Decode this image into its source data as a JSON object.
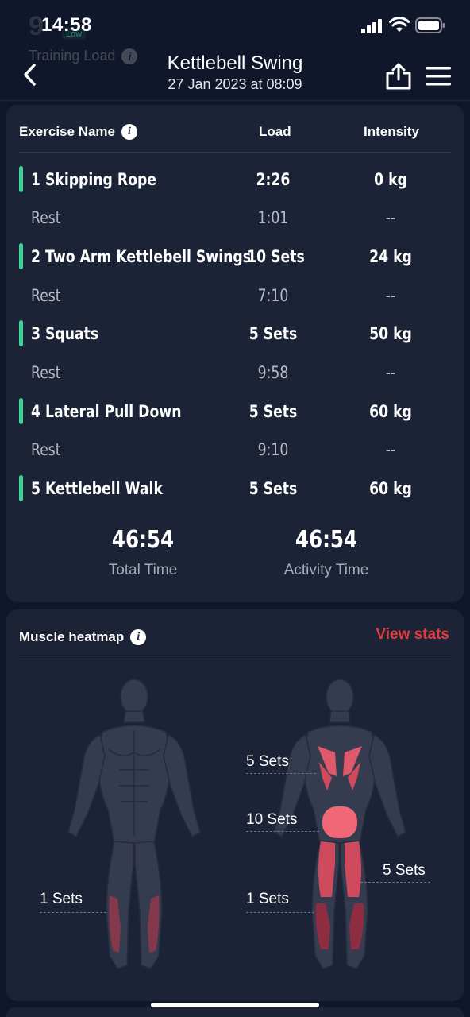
{
  "status_bar": {
    "time": "14:58",
    "ghost_number": "9",
    "ghost_badge": "Low"
  },
  "header": {
    "ghost_label": "Training Load",
    "title": "Kettlebell Swing",
    "subtitle": "27 Jan 2023 at 08:09",
    "icons": [
      "back-icon",
      "share-icon",
      "menu-icon"
    ]
  },
  "exercises": {
    "col_name": "Exercise Name",
    "col_load": "Load",
    "col_intensity": "Intensity",
    "accent_color": "#3fd49a",
    "rows": [
      {
        "name": "1 Skipping Rope",
        "load": "2:26",
        "intensity": "0 kg",
        "rest": false
      },
      {
        "name": "Rest",
        "load": "1:01",
        "intensity": "--",
        "rest": true
      },
      {
        "name": "2 Two Arm Kettlebell Swings",
        "load": "10 Sets",
        "intensity": "24 kg",
        "rest": false
      },
      {
        "name": "Rest",
        "load": "7:10",
        "intensity": "--",
        "rest": true
      },
      {
        "name": "3 Squats",
        "load": "5 Sets",
        "intensity": "50 kg",
        "rest": false
      },
      {
        "name": "Rest",
        "load": "9:58",
        "intensity": "--",
        "rest": true
      },
      {
        "name": "4 Lateral Pull Down",
        "load": "5 Sets",
        "intensity": "60 kg",
        "rest": false
      },
      {
        "name": "Rest",
        "load": "9:10",
        "intensity": "--",
        "rest": true
      },
      {
        "name": "5 Kettlebell Walk",
        "load": "5 Sets",
        "intensity": "60 kg",
        "rest": false
      }
    ],
    "total_time": "46:54",
    "total_time_label": "Total Time",
    "activity_time": "46:54",
    "activity_time_label": "Activity Time"
  },
  "heatmap": {
    "title": "Muscle heatmap",
    "view_stats": "View stats",
    "view_stats_color": "#e13d3d",
    "front_callouts": [
      "1 Sets"
    ],
    "back_callouts": [
      "5 Sets",
      "10 Sets",
      "1 Sets",
      "5 Sets"
    ]
  }
}
